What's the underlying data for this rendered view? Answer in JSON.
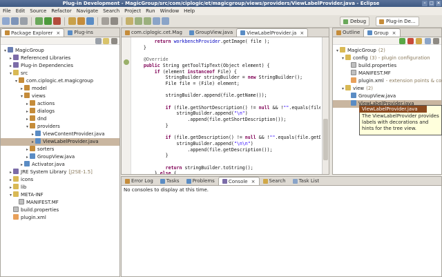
{
  "window": {
    "title": "Plug-in Development - MagicGroup/src/com/ciplogic/et/magicgroup/views/providers/ViewLabelProvider.java - Eclipse"
  },
  "menu": [
    "File",
    "Edit",
    "Source",
    "Refactor",
    "Navigate",
    "Search",
    "Project",
    "Run",
    "Window",
    "Help"
  ],
  "perspectives": {
    "debug": "Debug",
    "plugin": "Plug-in De..."
  },
  "explorer": {
    "tabs": [
      "Package Explorer",
      "Plug-ins"
    ],
    "tree": [
      {
        "label": "MagicGroup",
        "icon": "project-icon",
        "level": 0,
        "toggle": "▾"
      },
      {
        "label": "Referenced Libraries",
        "icon": "library-icon",
        "level": 1,
        "toggle": "▸"
      },
      {
        "label": "Plug-in Dependencies",
        "icon": "library-icon",
        "level": 1,
        "toggle": "▸"
      },
      {
        "label": "src",
        "icon": "folder-icon",
        "level": 1,
        "toggle": "▾"
      },
      {
        "label": "com.ciplogic.et.magicgroup",
        "icon": "package-icon",
        "level": 2,
        "toggle": "▾"
      },
      {
        "label": "model",
        "icon": "package-icon",
        "level": 3,
        "toggle": "▸"
      },
      {
        "label": "views",
        "icon": "package-icon",
        "level": 3,
        "toggle": "▾"
      },
      {
        "label": "actions",
        "icon": "package-icon",
        "level": 4,
        "toggle": "▸"
      },
      {
        "label": "dialogs",
        "icon": "package-icon",
        "level": 4,
        "toggle": "▸"
      },
      {
        "label": "dnd",
        "icon": "package-icon",
        "level": 4,
        "toggle": "▸"
      },
      {
        "label": "providers",
        "icon": "package-icon",
        "level": 4,
        "toggle": "▾"
      },
      {
        "label": "ViewContentProvider.java",
        "icon": "java-file-icon",
        "level": 5,
        "toggle": "▸"
      },
      {
        "label": "ViewLabelProvider.java",
        "icon": "java-file-icon",
        "level": 5,
        "toggle": "▸",
        "selected": true
      },
      {
        "label": "sorters",
        "icon": "package-icon",
        "level": 4,
        "toggle": "▸"
      },
      {
        "label": "GroupView.java",
        "icon": "java-file-icon",
        "level": 4,
        "toggle": "▸"
      },
      {
        "label": "Activator.java",
        "icon": "java-file-icon",
        "level": 3,
        "toggle": "▸"
      },
      {
        "label": "JRE System Library",
        "suffix": "[J2SE-1.5]",
        "icon": "library-icon",
        "level": 1,
        "toggle": "▸"
      },
      {
        "label": "icons",
        "icon": "folder-icon",
        "level": 1,
        "toggle": "▸"
      },
      {
        "label": "lib",
        "icon": "folder-icon",
        "level": 1,
        "toggle": "▸"
      },
      {
        "label": "META-INF",
        "icon": "folder-icon",
        "level": 1,
        "toggle": "▾"
      },
      {
        "label": "MANIFEST.MF",
        "icon": "file-icon",
        "level": 2,
        "toggle": ""
      },
      {
        "label": "build.properties",
        "icon": "file-icon",
        "level": 1,
        "toggle": ""
      },
      {
        "label": "plugin.xml",
        "icon": "xml-icon",
        "level": 1,
        "toggle": ""
      }
    ]
  },
  "editor": {
    "tabs": [
      "com.ciplogic.cet.Mag",
      "GroupView.java",
      "ViewLabelProvider.ja"
    ],
    "lines": [
      [
        {
          "t": "        "
        },
        {
          "t": "return ",
          "c": "kw"
        },
        {
          "t": "workbenchProvider",
          "c": "fld"
        },
        {
          "t": ".getImage( file );"
        }
      ],
      [
        {
          "t": "    }"
        }
      ],
      [
        {
          "t": ""
        }
      ],
      [
        {
          "t": "    "
        },
        {
          "t": "@Override",
          "c": "ann"
        }
      ],
      [
        {
          "t": "    "
        },
        {
          "t": "public ",
          "c": "kw"
        },
        {
          "t": "String getToolTipText(Object element) {"
        }
      ],
      [
        {
          "t": "        "
        },
        {
          "t": "if ",
          "c": "kw"
        },
        {
          "t": "(element "
        },
        {
          "t": "instanceof ",
          "c": "kw"
        },
        {
          "t": "File) {"
        }
      ],
      [
        {
          "t": "            StringBuilder stringBuilder = "
        },
        {
          "t": "new ",
          "c": "kw"
        },
        {
          "t": "StringBuilder();"
        }
      ],
      [
        {
          "t": "            File file = (File) element;"
        }
      ],
      [
        {
          "t": ""
        }
      ],
      [
        {
          "t": "            stringBuilder.append(file.getName());"
        }
      ],
      [
        {
          "t": ""
        }
      ],
      [
        {
          "t": "            "
        },
        {
          "t": "if ",
          "c": "kw"
        },
        {
          "t": "(file.getShortDescription() != "
        },
        {
          "t": "null ",
          "c": "kw"
        },
        {
          "t": "&& !"
        },
        {
          "t": "\"\"",
          "c": "str"
        },
        {
          "t": ".equals(file.getS"
        }
      ],
      [
        {
          "t": "                stringBuilder.append("
        },
        {
          "t": "\"\\n\"",
          "c": "str"
        },
        {
          "t": ")"
        }
      ],
      [
        {
          "t": "                    .append(file.getShortDescription());"
        }
      ],
      [
        {
          "t": "            }"
        }
      ],
      [
        {
          "t": ""
        }
      ],
      [
        {
          "t": "            "
        },
        {
          "t": "if ",
          "c": "kw"
        },
        {
          "t": "(file.getDescription() != "
        },
        {
          "t": "null ",
          "c": "kw"
        },
        {
          "t": "&& !"
        },
        {
          "t": "\"\"",
          "c": "str"
        },
        {
          "t": ".equals(file.getDescri"
        }
      ],
      [
        {
          "t": "                stringBuilder.append("
        },
        {
          "t": "\"\\n\\n\"",
          "c": "str"
        },
        {
          "t": ")"
        }
      ],
      [
        {
          "t": "                    .append(file.getDescription());"
        }
      ],
      [
        {
          "t": "            }"
        }
      ],
      [
        {
          "t": ""
        }
      ],
      [
        {
          "t": "            "
        },
        {
          "t": "return ",
          "c": "kw"
        },
        {
          "t": "stringBuilder.toString();"
        }
      ],
      [
        {
          "t": "        } "
        },
        {
          "t": "else ",
          "c": "kw"
        },
        {
          "t": "{"
        }
      ]
    ]
  },
  "bottom": {
    "tabs": [
      "Error Log",
      "Tasks",
      "Problems",
      "Console",
      "Search",
      "Task List"
    ],
    "message": "No consoles to display at this time."
  },
  "outline": {
    "tabs": [
      "Outline",
      "Group"
    ],
    "tree": [
      {
        "label": "MagicGroup",
        "suffix": "(2)",
        "icon": "folder-icon",
        "level": 0,
        "toggle": "▾"
      },
      {
        "label": "config",
        "suffix": "(3) - plugin configuration",
        "icon": "folder-icon",
        "level": 1,
        "toggle": "▾"
      },
      {
        "label": "build.properties",
        "icon": "file-icon",
        "level": 2,
        "toggle": ""
      },
      {
        "label": "MANIFEST.MF",
        "icon": "file-icon",
        "level": 2,
        "toggle": ""
      },
      {
        "label": "plugin.xml",
        "suffix": "- extension points & co",
        "icon": "xml-icon",
        "level": 2,
        "toggle": ""
      },
      {
        "label": "view",
        "suffix": "(2)",
        "icon": "folder-icon",
        "level": 1,
        "toggle": "▾"
      },
      {
        "label": "GroupView.java",
        "icon": "java-file-icon",
        "level": 2,
        "toggle": ""
      },
      {
        "label": "ViewLabelProvider.java",
        "icon": "java-file-icon",
        "level": 2,
        "toggle": "",
        "selected": true
      }
    ]
  },
  "tooltip": {
    "title": "ViewLabelProvider.java",
    "text": "The ViewLabelProvider provides labels with decorations and hints for the tree view."
  },
  "colors": {
    "selection": "#c9b6a0",
    "tooltip_bg": "#ffffdc",
    "keyword": "#7f0055",
    "string": "#2a00ff"
  }
}
